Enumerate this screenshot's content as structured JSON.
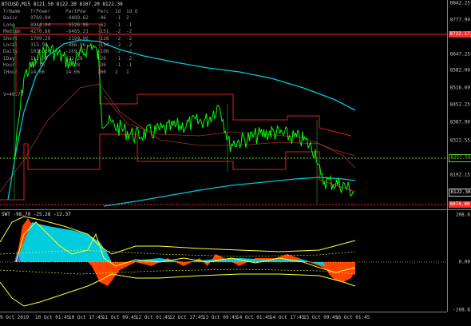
{
  "chart": {
    "title": "BTCUSD,M15  8121.50 8122.30 8107.20 8122.30",
    "sub_title": "SWT -98.70 -25.28 -12.37"
  },
  "info_table": {
    "headers": [
      "TrName",
      "TrPower",
      "PartPow",
      "Perc",
      "1d",
      "1d_O"
    ],
    "rows": [
      [
        "Basic",
        "9769.04",
        "-4489.62",
        "-46",
        "-1",
        "2"
      ],
      [
        "Long",
        "8944.04",
        "-5526.96",
        "-62",
        "-1",
        "-1"
      ],
      [
        "Medium",
        "4270.86",
        "-6465.21",
        "-151",
        "-2",
        "-2"
      ],
      [
        "Short",
        "1709.29",
        "-2199.96",
        "-128",
        "-2",
        "-2"
      ],
      [
        "Local",
        "315.98",
        "-486.06",
        "-154",
        "-2",
        "-2"
      ],
      [
        "Daily",
        "1035.60",
        "-169.07",
        "-108",
        "-2",
        "-2"
      ],
      [
        "IDay",
        "112.04",
        "-22.28",
        "-20",
        "-1",
        "-2"
      ],
      [
        "Hour",
        "23.16",
        "-8.28",
        "-36",
        "-1",
        "-1"
      ],
      [
        "IHour",
        "14.06",
        "14.06",
        "100",
        "2",
        "1"
      ]
    ],
    "volume": "V=40.79"
  },
  "price_axis": {
    "ticks": [
      "8842.25",
      "8777.90",
      "8712.20",
      "8647.25",
      "8582.00",
      "8516.60",
      "8452.25",
      "8387.90",
      "8322.55",
      "8251.59",
      "8192.15",
      "8122.30",
      "8074.80"
    ],
    "tag_red_top": "8722.17",
    "tag_green": "8251.59",
    "tag_current": "8122.30",
    "tag_red_bottom": "8074.80"
  },
  "sub_axis": {
    "ticks": [
      "208.8",
      "0.00",
      "-208.8"
    ]
  },
  "time_axis": {
    "ticks": [
      "9 Oct 2019",
      "10 Oct 01:45",
      "10 Oct 17:45",
      "11 Oct 09:45",
      "12 Oct 01:45",
      "12 Oct 17:45",
      "13 Oct 09:45",
      "14 Oct 01:45",
      "14 Oct 17:45",
      "15 Oct 09:45",
      "16 Oct 01:45"
    ]
  },
  "colors": {
    "background": "#000000",
    "candles": "#00ff00",
    "fast_ma": "#00c8d8",
    "level_red": "#ff2a2a",
    "level_green": "#66cc33",
    "channel_red": "#d42020",
    "swt_orange": "#ff4400",
    "swt_cyan": "#00ccdd",
    "swt_yellow": "#ffff33"
  }
}
